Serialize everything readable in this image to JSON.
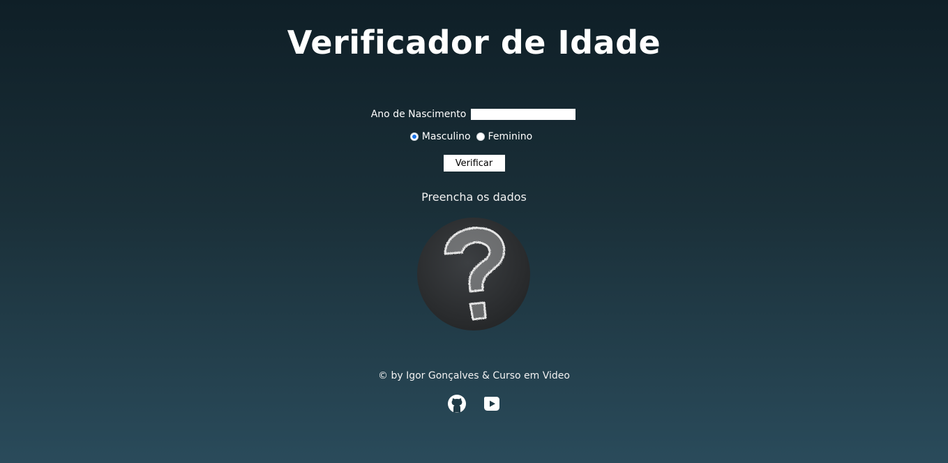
{
  "header": {
    "title": "Verificador de Idade"
  },
  "form": {
    "year_label": "Ano de Nascimento",
    "year_value": "",
    "sex_options": [
      {
        "label": "Masculino",
        "checked": true
      },
      {
        "label": "Feminino",
        "checked": false
      }
    ],
    "submit_label": "Verificar"
  },
  "result": {
    "text": "Preencha os dados",
    "image_icon": "question-mark-chalkboard"
  },
  "footer": {
    "credit": "© by Igor Gonçalves & Curso em Video",
    "links": [
      {
        "icon": "github-icon"
      },
      {
        "icon": "youtube-icon"
      }
    ]
  }
}
